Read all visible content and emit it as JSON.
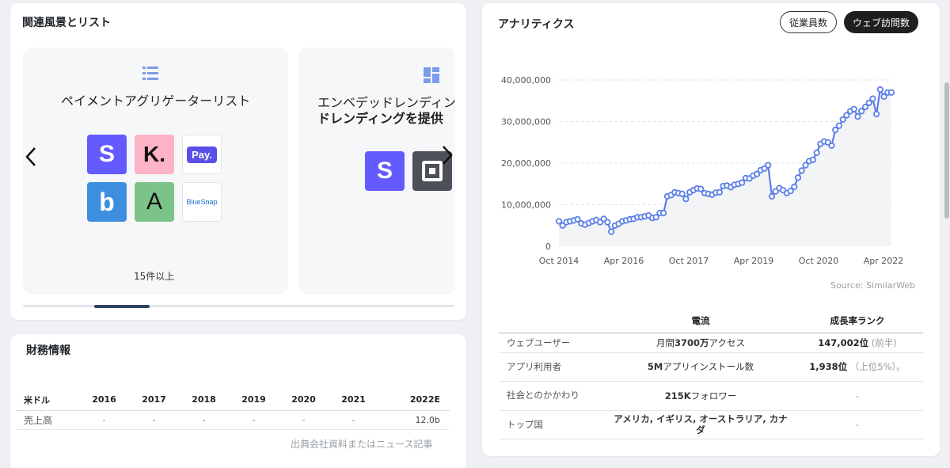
{
  "related": {
    "title": "関連風景とリスト",
    "slides": [
      {
        "icon": "list-icon",
        "title": "ペイメントアグリゲーターリスト",
        "count": "15件以上",
        "logos": [
          {
            "name": "logo-stripe",
            "text": "S",
            "bg": "#635bff",
            "fg": "#ffffff"
          },
          {
            "name": "logo-klarna",
            "text": "K.",
            "bg": "#ffb3c7",
            "fg": "#17120f"
          },
          {
            "name": "logo-pay",
            "text": "Pay.",
            "bg": "#ffffff",
            "fg": "#ffffff"
          },
          {
            "name": "logo-b",
            "text": "b",
            "bg": "#3e8ee0",
            "fg": "#ffffff"
          },
          {
            "name": "logo-a",
            "text": "A",
            "bg": "#7cc38a",
            "fg": "#111111"
          },
          {
            "name": "logo-bluesnap",
            "text": "BlueSnap",
            "bg": "#ffffff",
            "fg": "#1c6dd0"
          }
        ]
      },
      {
        "icon": "dashboard-icon",
        "title_line1": "エンベデッドレンディン",
        "title_line2": "ドレンディングを提供",
        "logos": [
          {
            "name": "logo-stripe-2",
            "text": "S",
            "bg": "#635bff",
            "fg": "#ffffff"
          },
          {
            "name": "logo-square",
            "text": "",
            "bg": "#4d5058",
            "fg": "#ffffff"
          }
        ]
      }
    ]
  },
  "finance": {
    "title": "財務情報",
    "headers": [
      "米ドル",
      "2016",
      "2017",
      "2018",
      "2019",
      "2020",
      "2021",
      "2022E"
    ],
    "rows": [
      [
        "売上高",
        "-",
        "-",
        "-",
        "-",
        "-",
        "-",
        "12.0b"
      ]
    ],
    "source": "出典会社資料またはニュース記事"
  },
  "analytics": {
    "title": "アナリティクス",
    "btn_employees": "従業員数",
    "btn_web": "ウェブ訪問数",
    "source": "Source: SimilarWeb",
    "table_headers": [
      "",
      "電流",
      "成長率ランク"
    ],
    "rows": [
      {
        "label": "ウェブユーザー",
        "current_pre": "月間",
        "current_bold": "3700万",
        "current_post": "アクセス",
        "rank_bold": "147,002位",
        "rank_note": "(前半)"
      },
      {
        "label": "アプリ利用者",
        "current_pre": "",
        "current_bold": "5M",
        "current_post": "アプリインストール数",
        "rank_bold": "1,938位",
        "rank_note": "（上位5%）。"
      },
      {
        "label": "社会とのかかわり",
        "current_pre": "",
        "current_bold": "215K",
        "current_post": "フォロワー",
        "rank_bold": "",
        "rank_note": "-"
      },
      {
        "label": "トップ国",
        "current_pre": "",
        "current_bold": "アメリカ, イギリス, オーストラリア, カナダ",
        "current_post": "",
        "rank_bold": "",
        "rank_note": "-"
      }
    ]
  },
  "chart_data": {
    "type": "line",
    "x_ticks": [
      "Oct 2014",
      "Apr 2016",
      "Oct 2017",
      "Apr 2019",
      "Oct 2020",
      "Apr 2022"
    ],
    "y_ticks": [
      "0",
      "10,000,000",
      "20,000,000",
      "30,000,000",
      "40,000,000"
    ],
    "ylim": [
      0,
      40000000
    ],
    "line_color": "#5b7fe6",
    "series": [
      {
        "values": [
          6000000,
          5000000,
          5800000,
          6000000,
          6200000,
          6500000,
          5500000,
          5200000,
          5600000,
          6000000,
          6300000,
          5800000,
          6600000,
          5800000,
          3500000,
          5000000,
          5400000,
          6000000,
          6200000,
          6500000,
          6600000,
          7000000,
          7000000,
          7200000,
          7400000,
          6800000,
          7000000,
          8000000,
          8000000,
          12000000,
          12300000,
          13000000,
          12800000,
          12600000,
          11400000,
          13000000,
          13500000,
          13900000,
          13800000,
          12800000,
          12600000,
          12400000,
          12900000,
          13000000,
          14500000,
          14600000,
          14200000,
          14800000,
          15000000,
          15300000,
          16400000,
          16300000,
          17000000,
          17400000,
          18300000,
          18700000,
          19500000,
          12000000,
          13200000,
          14000000,
          13500000,
          12800000,
          13300000,
          14300000,
          16500000,
          18200000,
          19500000,
          20500000,
          20800000,
          22500000,
          24600000,
          25200000,
          25000000,
          24200000,
          28000000,
          29000000,
          30500000,
          31500000,
          32500000,
          33000000,
          31200000,
          32500000,
          33500000,
          34500000,
          35500000,
          31800000,
          37700000,
          36000000,
          37000000,
          37000000
        ]
      }
    ]
  }
}
